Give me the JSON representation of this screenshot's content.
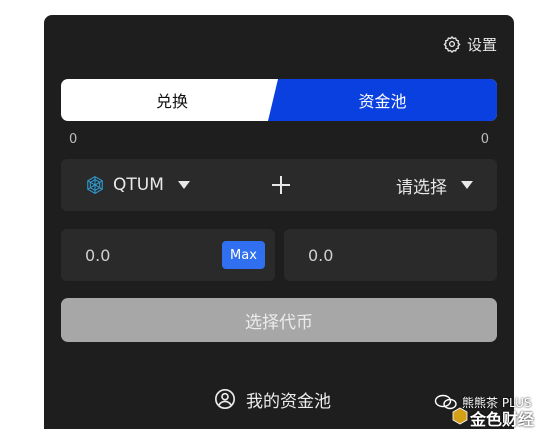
{
  "header": {
    "settings_label": "设置"
  },
  "tabs": [
    {
      "label": "兑换",
      "active": false
    },
    {
      "label": "资金池",
      "active": true
    }
  ],
  "balances": {
    "left": "0",
    "right": "0"
  },
  "token_row": {
    "token_a": {
      "symbol": "QTUM",
      "icon": "qtum-icon"
    },
    "token_b": {
      "label": "请选择"
    }
  },
  "amounts": {
    "a": {
      "value": "0.0"
    },
    "b": {
      "value": "0.0"
    },
    "max_label": "Max"
  },
  "actions": {
    "select_token_label": "选择代币",
    "my_pool_label": "我的资金池"
  },
  "watermark": {
    "account": "熊熊茶 PLUS",
    "brand": "金色财经"
  },
  "colors": {
    "panel_bg": "#1e1e1e",
    "card_bg": "#2a2a2a",
    "accent_blue": "#0a3fe0",
    "max_blue": "#2f6ff0",
    "disabled_button": "#a7a7a7",
    "qtum": "#2e9ad0"
  }
}
